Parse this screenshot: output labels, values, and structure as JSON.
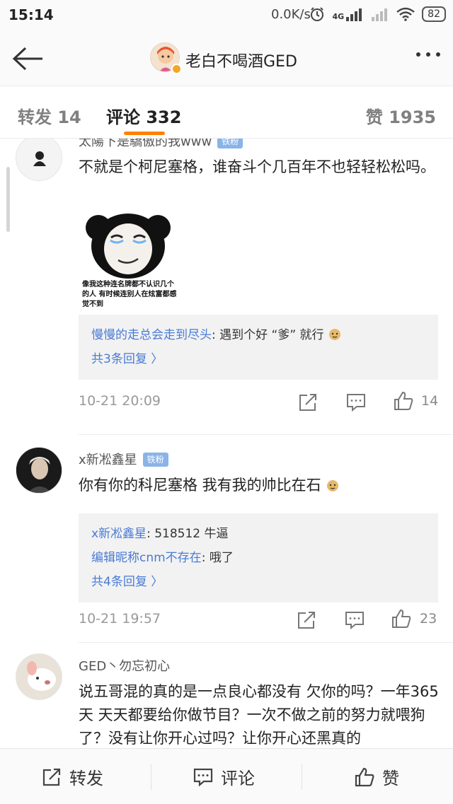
{
  "status_bar": {
    "time": "15:14",
    "net_speed": "0.0K/s",
    "network_label": "4G",
    "battery": "82"
  },
  "header": {
    "title": "老白不喝酒GED",
    "back_icon": "back-arrow-icon",
    "more_icon": "more-dots-icon"
  },
  "tabs": [
    {
      "label": "转发 14"
    },
    {
      "label": "评论 332",
      "active": true
    },
    {
      "label": "赞 1935"
    }
  ],
  "comments": [
    {
      "name": "太陽下是驕傲的我www",
      "badge": "铁粉",
      "text": "不就是个柯尼塞格，谁奋斗个几百年不也轻轻松松吗。",
      "meme_caption": "像我这种连名牌都不认识几个的人 有时候连别人在炫富都感觉不到",
      "replies": [
        {
          "author": "慢慢的走总会走到尽头",
          "text": ": 遇到个好 “爹” 就行"
        }
      ],
      "reply_more": "共3条回复 〉",
      "time": "10-21 20:09",
      "likes": "14"
    },
    {
      "name": "x新凇鑫星",
      "badge": "铁粉",
      "text": "你有你的科尼塞格 我有我的帅比在石",
      "replies": [
        {
          "author": "x新凇鑫星",
          "text": ": 518512 牛逼"
        },
        {
          "author": "编辑昵称cnm不存在",
          "text": ": 哦了"
        }
      ],
      "reply_more": "共4条回复 〉",
      "time": "10-21 19:57",
      "likes": "23"
    },
    {
      "name": "GED丶勿忘初心",
      "text": "说五哥混的真的是一点良心都没有 欠你的吗？一年365天 天天都要给你做节目？一次不做之前的努力就喂狗了？没有让你开心过吗？让你开心还黑真的"
    }
  ],
  "bottom_bar": {
    "repost": "转发",
    "comment": "评论",
    "like": "赞"
  },
  "colors": {
    "accent": "#ff8200",
    "link": "#4a7bd4",
    "badge": "#8ab4e8"
  }
}
